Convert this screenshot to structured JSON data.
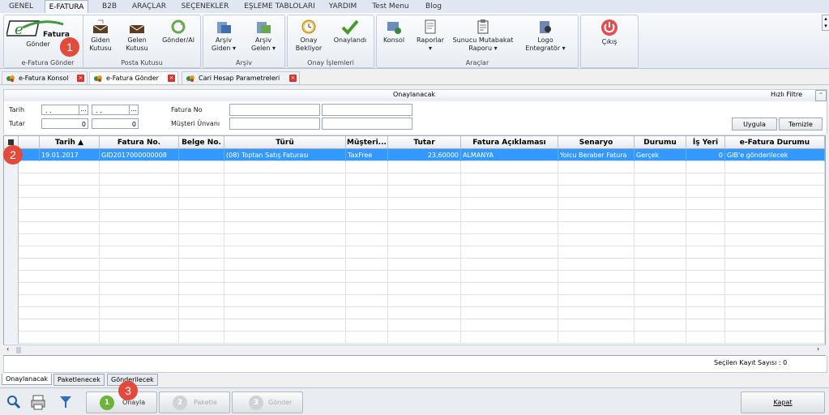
{
  "menu": [
    "GENEL",
    "E-FATURA",
    "B2B",
    "ARAÇLAR",
    "SEÇENEKLER",
    "EŞLEME TABLOLARI",
    "YARDIM",
    "Test Menu",
    "Blog"
  ],
  "ribbon": {
    "groups": [
      "e-Fatura Gönder",
      "Posta Kutusu",
      "Arşiv",
      "Onay İşlemleri",
      "Araçlar"
    ],
    "logo_text": "Fatura",
    "buttons": {
      "gonder": "Gönder",
      "giden_kutusu_1": "Giden",
      "giden_kutusu_2": "Kutusu",
      "gelen_kutusu_1": "Gelen",
      "gelen_kutusu_2": "Kutusu",
      "gonder_al": "Gönder/Al",
      "arsiv_giden_1": "Arşiv",
      "arsiv_giden_2": "Giden",
      "arsiv_gelen_1": "Arşiv",
      "arsiv_gelen_2": "Gelen",
      "onay_bekliyor_1": "Onay",
      "onay_bekliyor_2": "Bekliyor",
      "onaylandi": "Onaylandı",
      "konsol": "Konsol",
      "raporlar": "Raporlar",
      "sunucu_1": "Sunucu Mutabakat",
      "sunucu_2": "Raporu",
      "logo_1": "Logo",
      "logo_2": "Entegratör",
      "cikis": "Çıkış"
    }
  },
  "doc_tabs": [
    "e-Fatura Konsol",
    "e-Fatura Gönder",
    "Cari Hesap Parametreleri"
  ],
  "panel": {
    "title": "Onaylanacak",
    "quick_filter": "Hızlı Filtre"
  },
  "filters": {
    "tarih_label": "Tarih",
    "tutar_label": "Tutar",
    "fatura_no_label": "Fatura No",
    "musteri_label": "Müşteri Ünvanı",
    "date1": ". .",
    "date2": ". .",
    "tutar1": "0",
    "tutar2": "0",
    "apply": "Uygula",
    "clear": "Temizle"
  },
  "table": {
    "columns": [
      "Tarih",
      "Fatura No.",
      "Belge No.",
      "Türü",
      "Müşteri...",
      "Tutar",
      "Fatura Açıklaması",
      "Senaryo",
      "Durumu",
      "İş Yeri",
      "e-Fatura Durumu"
    ],
    "rows": [
      {
        "tarih": "19.01.2017",
        "fatura_no": "GID2017000000008",
        "belge_no": "",
        "turu": "(08) Toptan Satış Faturası",
        "musteri": "TaxFree",
        "tutar": "23,60000",
        "aciklama": "ALMANYA",
        "senaryo": "Yolcu Beraber Fatura",
        "durumu": "Gerçek",
        "is_yeri": "0",
        "efatura_durumu": "GIB'e gönderilecek"
      }
    ]
  },
  "footer": {
    "selected_count": "Seçilen Kayıt Sayısı : 0"
  },
  "bottom_tabs": [
    "Onaylanacak",
    "Paketlenecek",
    "Gönderilecek"
  ],
  "steps": [
    {
      "num": "1",
      "label": "Onayla"
    },
    {
      "num": "2",
      "label": "Paketle"
    },
    {
      "num": "3",
      "label": "Gönder"
    }
  ],
  "close_label": "Kapat",
  "markers": [
    "1",
    "2",
    "3"
  ]
}
